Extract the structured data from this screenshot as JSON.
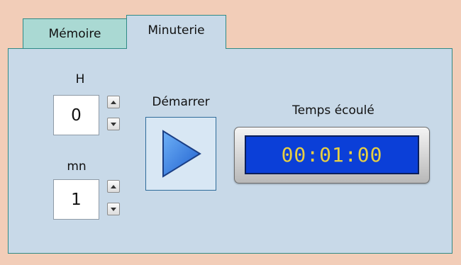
{
  "tabs": [
    {
      "label": "Mémoire",
      "active": false
    },
    {
      "label": "Minuterie",
      "active": true
    }
  ],
  "timer": {
    "hours": {
      "label": "H",
      "value": "0"
    },
    "minutes": {
      "label": "mn",
      "value": "1"
    },
    "start": {
      "label": "Démarrer",
      "icon": "play-icon"
    },
    "elapsed": {
      "label": "Temps écoulé",
      "value": "00:01:00"
    }
  },
  "colors": {
    "window_bg": "#f2cdb8",
    "panel_bg": "#c8d9e8",
    "inactive_tab_bg": "#aad9d3",
    "border": "#2f8a86",
    "display_bg": "#0b3fd8",
    "display_text": "#e8cf43",
    "play_fill": "#3b82e6"
  }
}
